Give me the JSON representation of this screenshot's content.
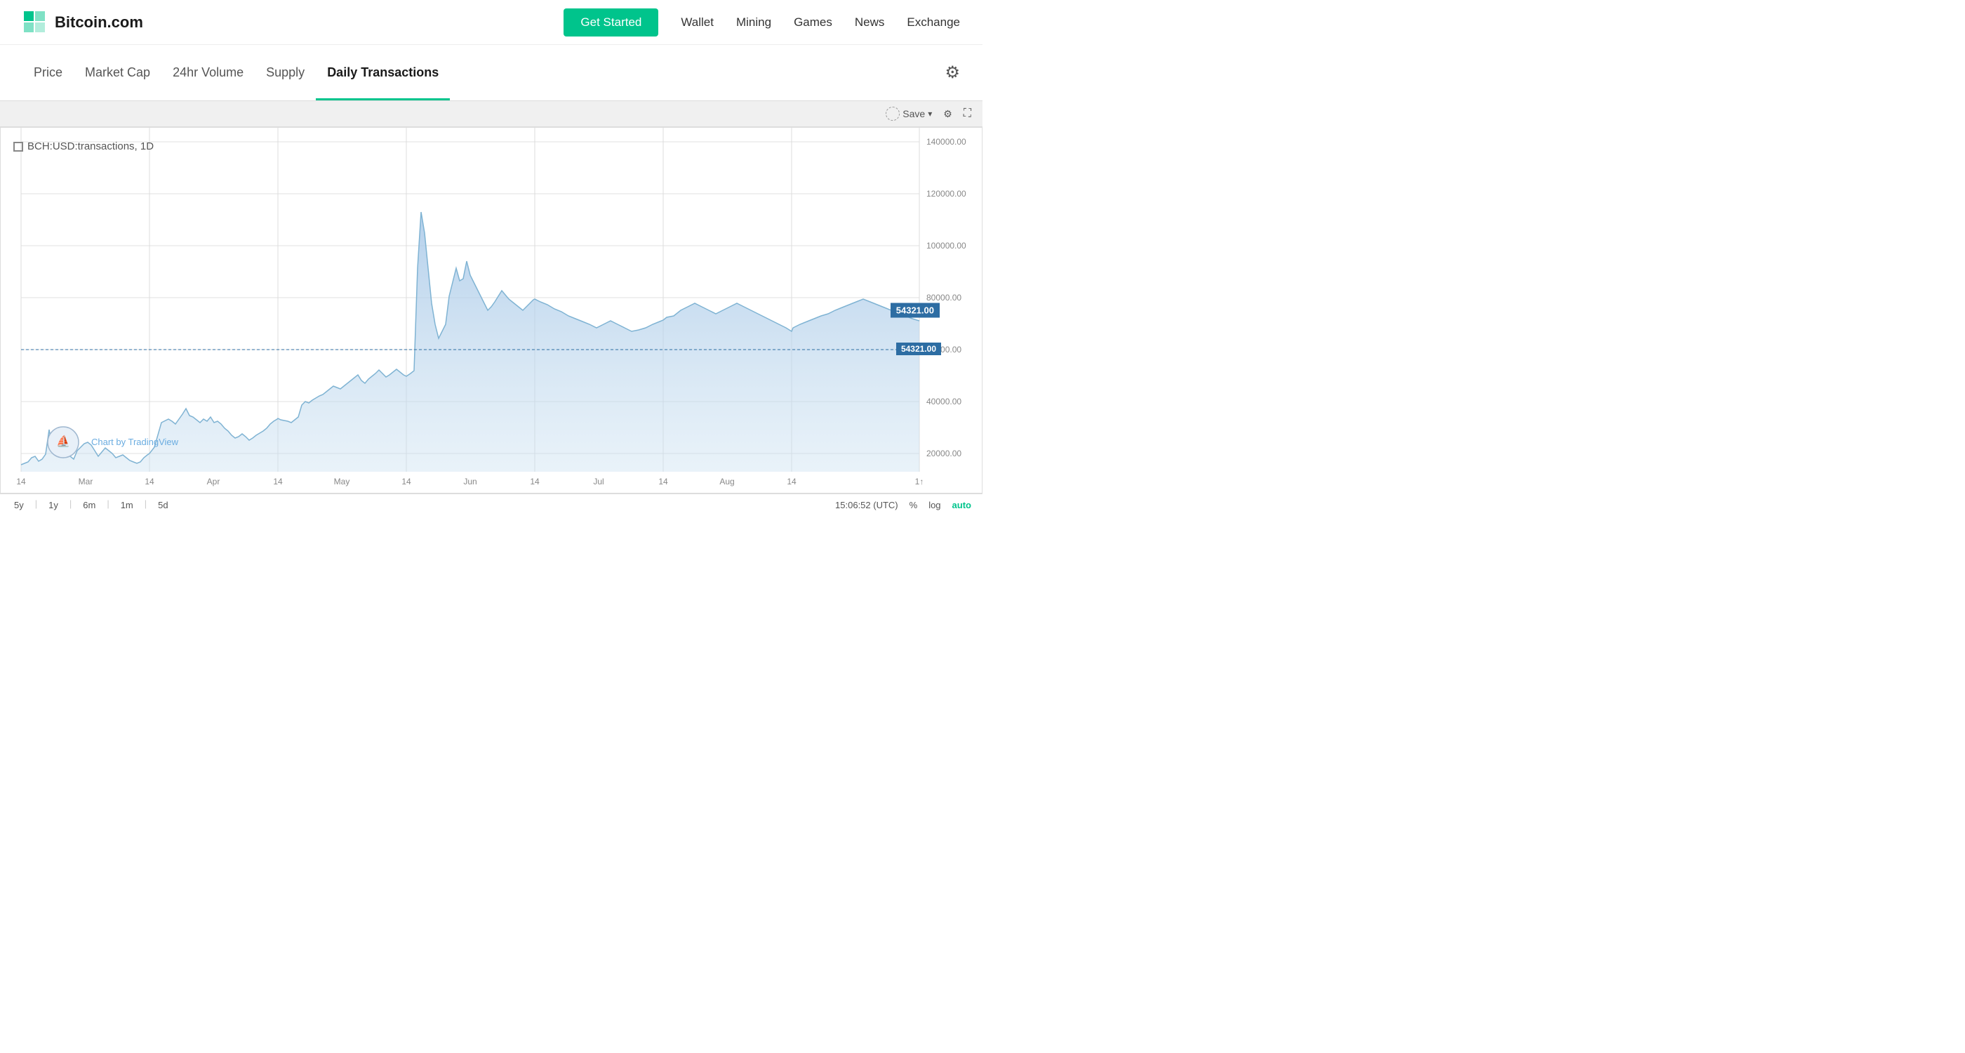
{
  "header": {
    "logo_text": "Bitcoin.com",
    "nav_items": [
      {
        "label": "Get Started",
        "active": false,
        "cta": true
      },
      {
        "label": "Wallet",
        "active": false
      },
      {
        "label": "Mining",
        "active": false
      },
      {
        "label": "Games",
        "active": false
      },
      {
        "label": "News",
        "active": false
      },
      {
        "label": "Exchange",
        "active": false
      }
    ]
  },
  "tabs": [
    {
      "label": "Price",
      "active": false
    },
    {
      "label": "Market Cap",
      "active": false
    },
    {
      "label": "24hr Volume",
      "active": false
    },
    {
      "label": "Supply",
      "active": false
    },
    {
      "label": "Daily Transactions",
      "active": true
    }
  ],
  "chart": {
    "title": "BCH:USD:transactions, 1D",
    "current_value": "54321.00",
    "y_labels": [
      "140000.00",
      "120000.00",
      "100000.00",
      "80000.00",
      "60000.00",
      "40000.00",
      "20000.00"
    ],
    "x_labels": [
      "14",
      "Mar",
      "14",
      "Apr",
      "14",
      "May",
      "14",
      "Jun",
      "14",
      "Jul",
      "14",
      "Aug",
      "1↑"
    ],
    "toolbar": {
      "save_label": "Save",
      "timestamp": "15:06:52 (UTC)"
    }
  },
  "timeframes": [
    "5y",
    "1y",
    "6m",
    "1m",
    "5d"
  ],
  "bottom_controls": {
    "timestamp": "15:06:52 (UTC)",
    "percent_label": "%",
    "log_label": "log",
    "auto_label": "auto"
  }
}
